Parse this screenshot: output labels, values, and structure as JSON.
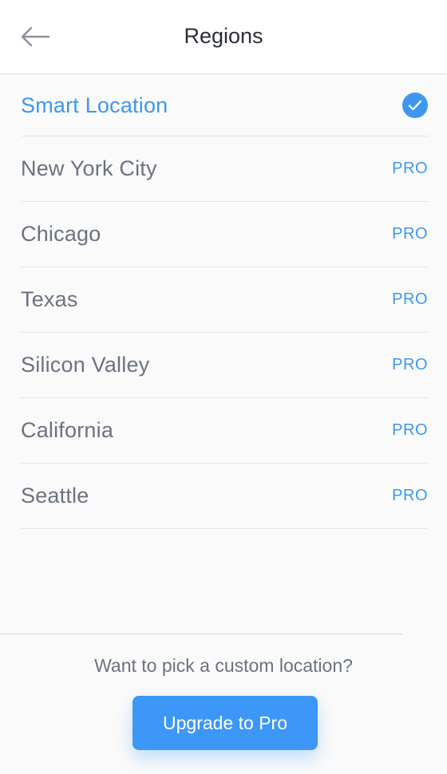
{
  "header": {
    "title": "Regions"
  },
  "list": {
    "selected": {
      "label": "Smart Location"
    },
    "items": [
      {
        "label": "New York City",
        "tag": "PRO"
      },
      {
        "label": "Chicago",
        "tag": "PRO"
      },
      {
        "label": "Texas",
        "tag": "PRO"
      },
      {
        "label": "Silicon Valley",
        "tag": "PRO"
      },
      {
        "label": "California",
        "tag": "PRO"
      },
      {
        "label": "Seattle",
        "tag": "PRO"
      }
    ]
  },
  "footer": {
    "prompt": "Want to pick a custom location?",
    "button_label": "Upgrade to Pro"
  },
  "colors": {
    "accent": "#3d97ef",
    "text_muted": "#6b7280"
  },
  "icons": {
    "back": "arrow-left-icon",
    "check": "checkmark-circle-icon"
  }
}
